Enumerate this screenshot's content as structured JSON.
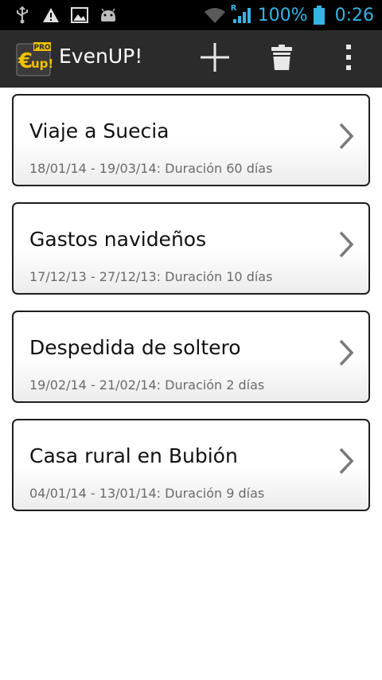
{
  "status_bar": {
    "battery_percent": "100%",
    "time": "0:26",
    "network_badge": "R",
    "icons": [
      "usb-icon",
      "warning-icon",
      "image-icon",
      "android-icon",
      "wifi-icon",
      "signal-icon",
      "battery-icon"
    ],
    "color": "#33b5e5"
  },
  "action_bar": {
    "title": "EvenUP!",
    "logo": {
      "letters": "€up!",
      "badge": "PRO"
    },
    "actions": [
      "add-icon",
      "delete-icon",
      "overflow-menu-icon"
    ],
    "background": "#2b2b2b"
  },
  "events": [
    {
      "title": "Viaje a Suecia",
      "subtitle": "18/01/14 - 19/03/14: Duración 60 días"
    },
    {
      "title": "Gastos navideños",
      "subtitle": "17/12/13 - 27/12/13: Duración 10 días"
    },
    {
      "title": "Despedida de soltero",
      "subtitle": "19/02/14 - 21/02/14: Duración 2 días"
    },
    {
      "title": "Casa rural en Bubión",
      "subtitle": "04/01/14 - 13/01/14: Duración 9 días"
    }
  ]
}
